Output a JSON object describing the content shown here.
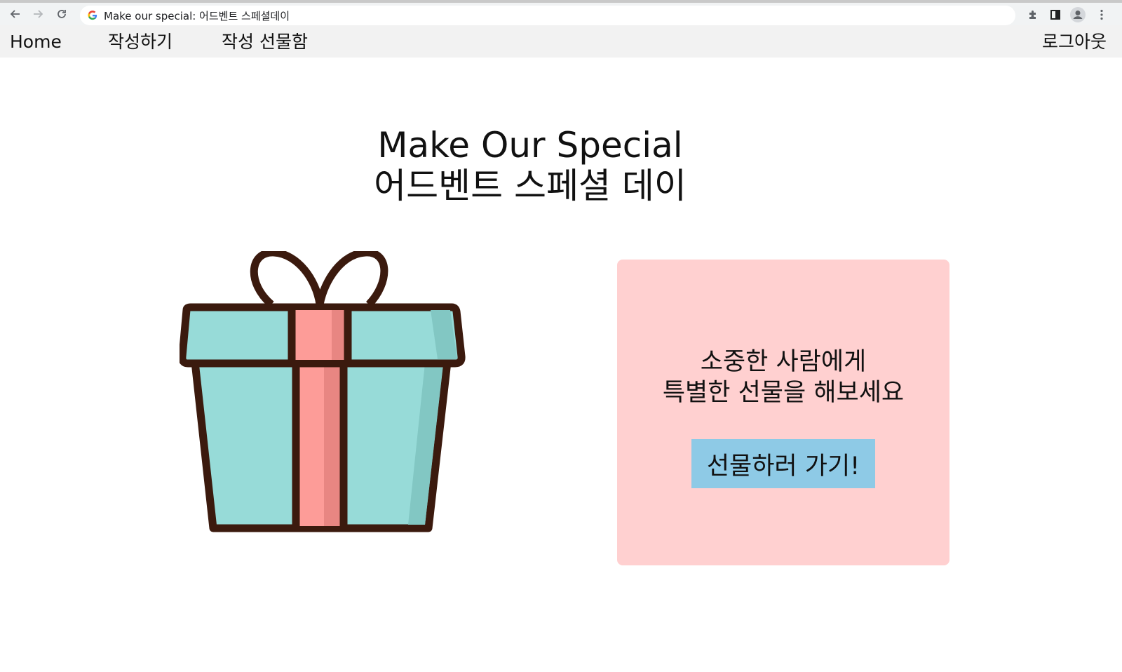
{
  "browser": {
    "back_icon": "arrow-left-icon",
    "forward_icon": "arrow-right-icon",
    "reload_icon": "reload-icon",
    "tab_title": "Make our special: 어드벤트 스페셜데이",
    "right_icons": [
      "extension-puzzle-icon",
      "side-panel-icon",
      "profile-avatar-icon",
      "kebab-menu-icon"
    ]
  },
  "nav": {
    "home": "Home",
    "write": "작성하기",
    "giftbox": "작성 선물함",
    "logout": "로그아웃"
  },
  "hero": {
    "title_line1": "Make Our Special",
    "title_line2": "어드벤트 스페셜 데이"
  },
  "card": {
    "line1": "소중한 사람에게",
    "line2": "특별한 선물을 해보세요",
    "button": "선물하러 가기!"
  },
  "colors": {
    "card_bg": "#ffd0d0",
    "button_bg": "#8ecae6",
    "gift_box": "#97dbd8",
    "gift_ribbon": "#fd9c98",
    "gift_outline": "#3b1a0e"
  }
}
